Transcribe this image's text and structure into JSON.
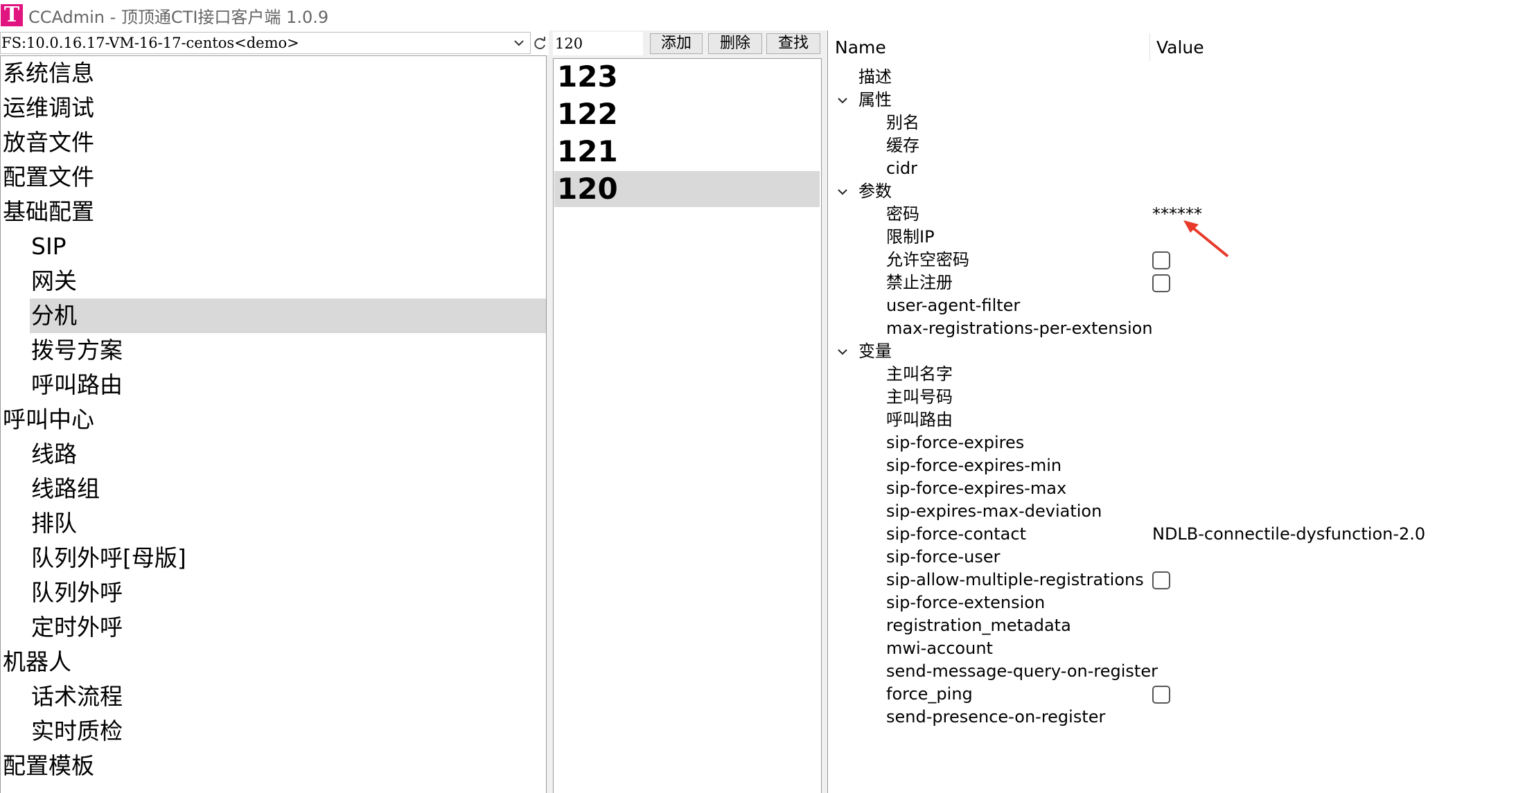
{
  "window": {
    "title": "CCAdmin - 顶顶通CTI接口客户端 1.0.9",
    "logo_letter": "T",
    "logo_color": "#e0157f"
  },
  "server": {
    "selected": "FS:10.0.16.17-VM-16-17-centos<demo>"
  },
  "left_tree": {
    "items": [
      {
        "label": "系统信息",
        "level": 0
      },
      {
        "label": "运维调试",
        "level": 0
      },
      {
        "label": "放音文件",
        "level": 0
      },
      {
        "label": "配置文件",
        "level": 0
      },
      {
        "label": "基础配置",
        "level": 0
      },
      {
        "label": "SIP",
        "level": 1
      },
      {
        "label": "网关",
        "level": 1
      },
      {
        "label": "分机",
        "level": 1,
        "selected": true
      },
      {
        "label": "拨号方案",
        "level": 1
      },
      {
        "label": "呼叫路由",
        "level": 1
      },
      {
        "label": "呼叫中心",
        "level": 0
      },
      {
        "label": "线路",
        "level": 1
      },
      {
        "label": "线路组",
        "level": 1
      },
      {
        "label": "排队",
        "level": 1
      },
      {
        "label": "队列外呼[母版]",
        "level": 1
      },
      {
        "label": "队列外呼",
        "level": 1
      },
      {
        "label": "定时外呼",
        "level": 1
      },
      {
        "label": "机器人",
        "level": 0
      },
      {
        "label": "话术流程",
        "level": 1
      },
      {
        "label": "实时质检",
        "level": 1
      },
      {
        "label": "配置模板",
        "level": 0
      }
    ]
  },
  "extensions": {
    "input_value": "120",
    "add_label": "添加",
    "delete_label": "删除",
    "find_label": "查找",
    "items": [
      "123",
      "122",
      "121",
      "120"
    ],
    "selected": "120"
  },
  "property_grid": {
    "name_header": "Name",
    "value_header": "Value",
    "rows": [
      {
        "name": "描述",
        "level": 0
      },
      {
        "name": "属性",
        "level": 0,
        "group": true
      },
      {
        "name": "别名",
        "level": 1
      },
      {
        "name": "缓存",
        "level": 1
      },
      {
        "name": "cidr",
        "level": 1
      },
      {
        "name": "参数",
        "level": 0,
        "group": true
      },
      {
        "name": "密码",
        "level": 1,
        "value": "******"
      },
      {
        "name": "限制IP",
        "level": 1
      },
      {
        "name": "允许空密码",
        "level": 1,
        "checkbox": true
      },
      {
        "name": "禁止注册",
        "level": 1,
        "checkbox": true
      },
      {
        "name": "user-agent-filter",
        "level": 1
      },
      {
        "name": "max-registrations-per-extension",
        "level": 1
      },
      {
        "name": "变量",
        "level": 0,
        "group": true
      },
      {
        "name": "主叫名字",
        "level": 1
      },
      {
        "name": "主叫号码",
        "level": 1
      },
      {
        "name": "呼叫路由",
        "level": 1
      },
      {
        "name": "sip-force-expires",
        "level": 1
      },
      {
        "name": "sip-force-expires-min",
        "level": 1
      },
      {
        "name": "sip-force-expires-max",
        "level": 1
      },
      {
        "name": "sip-expires-max-deviation",
        "level": 1
      },
      {
        "name": "sip-force-contact",
        "level": 1,
        "value": "NDLB-connectile-dysfunction-2.0"
      },
      {
        "name": "sip-force-user",
        "level": 1
      },
      {
        "name": "sip-allow-multiple-registrations",
        "level": 1,
        "checkbox": true
      },
      {
        "name": "sip-force-extension",
        "level": 1
      },
      {
        "name": "registration_metadata",
        "level": 1
      },
      {
        "name": "mwi-account",
        "level": 1
      },
      {
        "name": "send-message-query-on-register",
        "level": 1
      },
      {
        "name": "force_ping",
        "level": 1,
        "checkbox": true
      },
      {
        "name": "send-presence-on-register",
        "level": 1
      }
    ]
  },
  "annotation": {
    "arrow_color": "#e8392a"
  }
}
